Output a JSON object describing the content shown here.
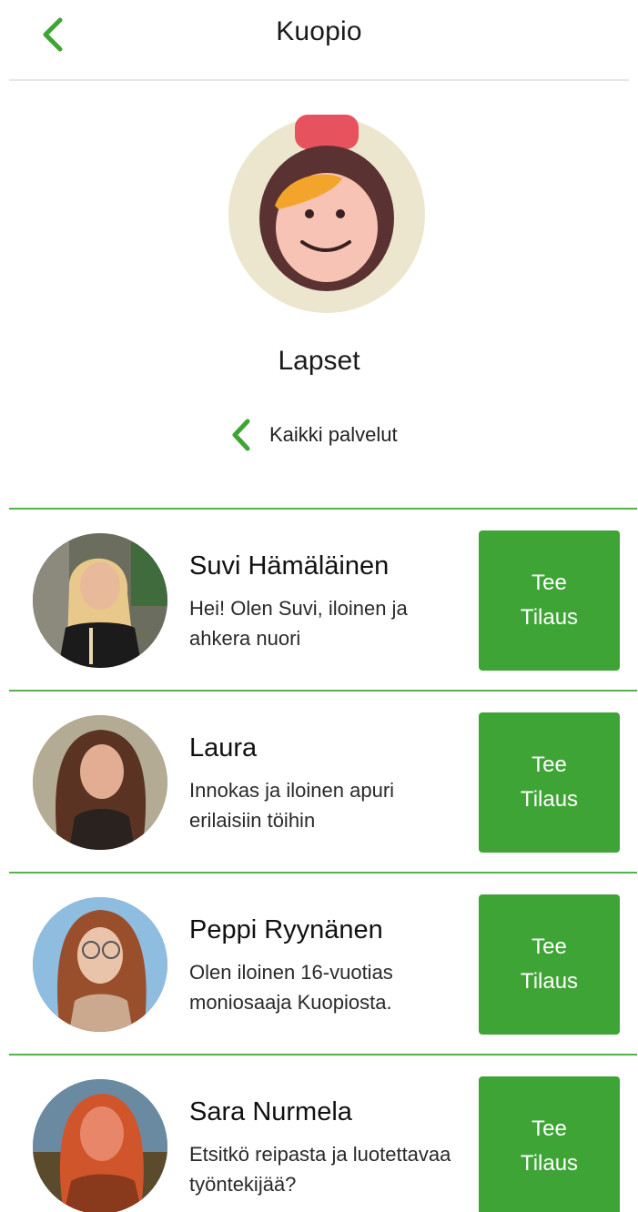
{
  "header": {
    "title": "Kuopio",
    "accent_color": "#3fa436",
    "back_icon": "chevron-left-icon"
  },
  "category": {
    "title": "Lapset",
    "icon": "child-avatar-icon",
    "all_services_label": "Kaikki palvelut",
    "all_services_icon": "chevron-left-icon"
  },
  "helpers": [
    {
      "name": "Suvi Hämäläinen",
      "description": "Hei! Olen Suvi, iloinen ja ahkera nuori",
      "button": {
        "line1": "Tee",
        "line2": "Tilaus"
      }
    },
    {
      "name": "Laura",
      "description": "Innokas ja iloinen apuri erilaisiin töihin",
      "button": {
        "line1": "Tee",
        "line2": "Tilaus"
      }
    },
    {
      "name": "Peppi Ryynänen",
      "description": "Olen iloinen 16-vuotias moniosaaja Kuopiosta.",
      "button": {
        "line1": "Tee",
        "line2": "Tilaus"
      }
    },
    {
      "name": "Sara Nurmela",
      "description": "Etsitkö reipasta ja luotettavaa työntekijää?",
      "button": {
        "line1": "Tee",
        "line2": "Tilaus"
      }
    }
  ]
}
